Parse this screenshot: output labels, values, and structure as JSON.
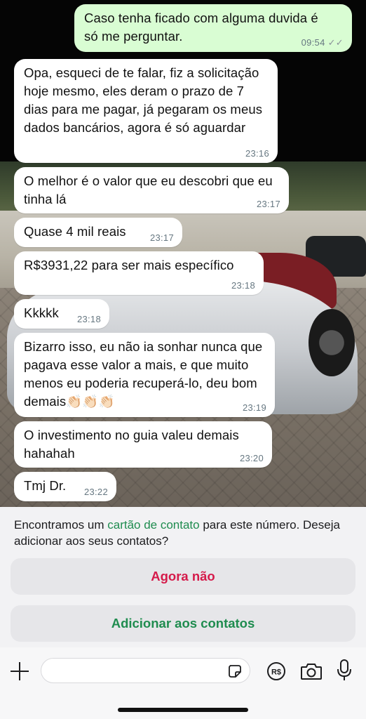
{
  "chat": {
    "messages": [
      {
        "direction": "outgoing",
        "text_line1": "Caso tenha ficado com alguma duvida é",
        "text_line2": "só me perguntar.",
        "time": "09:54",
        "status": "read"
      },
      {
        "direction": "incoming",
        "text": "Opa, esqueci de te falar, fiz a solicitação hoje mesmo, eles deram o prazo de 7 dias para me pagar, já pegaram os meus dados bancários, agora é só aguardar",
        "time": "23:16"
      },
      {
        "direction": "incoming",
        "text": "O melhor é o valor que eu descobri que eu tinha lá",
        "time": "23:17"
      },
      {
        "direction": "incoming",
        "text": "Quase 4 mil reais",
        "time": "23:17"
      },
      {
        "direction": "incoming",
        "text": "R$3931,22 para ser mais específico",
        "time": "23:18"
      },
      {
        "direction": "incoming",
        "text": "Kkkkk",
        "time": "23:18"
      },
      {
        "direction": "incoming",
        "text": "Bizarro isso, eu não ia sonhar nunca que pagava esse valor a mais, e que muito menos eu poderia recuperá-lo, deu bom demais👏🏻👏🏻👏🏻",
        "time": "23:19"
      },
      {
        "direction": "incoming",
        "text": "O investimento no guia valeu demais hahahah",
        "time": "23:20"
      },
      {
        "direction": "incoming",
        "text": "Tmj Dr.",
        "time": "23:22"
      }
    ]
  },
  "contact_banner": {
    "text_before": "Encontramos um ",
    "link_text": "cartão de contato",
    "text_after": " para este número. Deseja adicionar aos seus contatos?",
    "decline_label": "Agora não",
    "add_label": "Adicionar aos contatos",
    "decline_color": "#d51a4a",
    "add_color": "#1f8c4f"
  },
  "composer": {
    "input_value": "",
    "icons": [
      "plus-icon",
      "sticker-icon",
      "payment-icon",
      "camera-icon",
      "microphone-icon"
    ],
    "payment_icon_text": "R$"
  },
  "colors": {
    "outgoing_bubble": "#d9fdd3",
    "incoming_bubble": "#ffffff",
    "timestamp": "#667781"
  }
}
